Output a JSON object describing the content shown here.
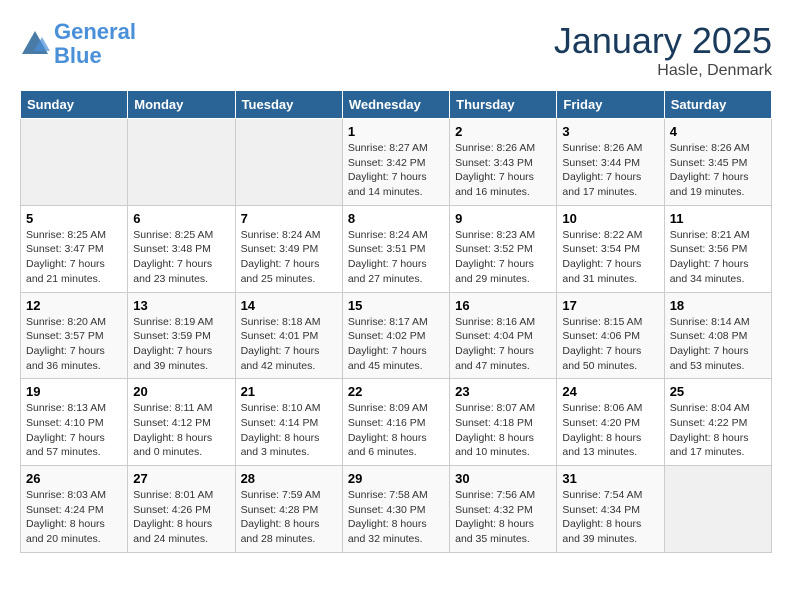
{
  "header": {
    "logo_line1": "General",
    "logo_line2": "Blue",
    "month": "January 2025",
    "location": "Hasle, Denmark"
  },
  "days_of_week": [
    "Sunday",
    "Monday",
    "Tuesday",
    "Wednesday",
    "Thursday",
    "Friday",
    "Saturday"
  ],
  "weeks": [
    [
      {
        "num": "",
        "info": ""
      },
      {
        "num": "",
        "info": ""
      },
      {
        "num": "",
        "info": ""
      },
      {
        "num": "1",
        "info": "Sunrise: 8:27 AM\nSunset: 3:42 PM\nDaylight: 7 hours\nand 14 minutes."
      },
      {
        "num": "2",
        "info": "Sunrise: 8:26 AM\nSunset: 3:43 PM\nDaylight: 7 hours\nand 16 minutes."
      },
      {
        "num": "3",
        "info": "Sunrise: 8:26 AM\nSunset: 3:44 PM\nDaylight: 7 hours\nand 17 minutes."
      },
      {
        "num": "4",
        "info": "Sunrise: 8:26 AM\nSunset: 3:45 PM\nDaylight: 7 hours\nand 19 minutes."
      }
    ],
    [
      {
        "num": "5",
        "info": "Sunrise: 8:25 AM\nSunset: 3:47 PM\nDaylight: 7 hours\nand 21 minutes."
      },
      {
        "num": "6",
        "info": "Sunrise: 8:25 AM\nSunset: 3:48 PM\nDaylight: 7 hours\nand 23 minutes."
      },
      {
        "num": "7",
        "info": "Sunrise: 8:24 AM\nSunset: 3:49 PM\nDaylight: 7 hours\nand 25 minutes."
      },
      {
        "num": "8",
        "info": "Sunrise: 8:24 AM\nSunset: 3:51 PM\nDaylight: 7 hours\nand 27 minutes."
      },
      {
        "num": "9",
        "info": "Sunrise: 8:23 AM\nSunset: 3:52 PM\nDaylight: 7 hours\nand 29 minutes."
      },
      {
        "num": "10",
        "info": "Sunrise: 8:22 AM\nSunset: 3:54 PM\nDaylight: 7 hours\nand 31 minutes."
      },
      {
        "num": "11",
        "info": "Sunrise: 8:21 AM\nSunset: 3:56 PM\nDaylight: 7 hours\nand 34 minutes."
      }
    ],
    [
      {
        "num": "12",
        "info": "Sunrise: 8:20 AM\nSunset: 3:57 PM\nDaylight: 7 hours\nand 36 minutes."
      },
      {
        "num": "13",
        "info": "Sunrise: 8:19 AM\nSunset: 3:59 PM\nDaylight: 7 hours\nand 39 minutes."
      },
      {
        "num": "14",
        "info": "Sunrise: 8:18 AM\nSunset: 4:01 PM\nDaylight: 7 hours\nand 42 minutes."
      },
      {
        "num": "15",
        "info": "Sunrise: 8:17 AM\nSunset: 4:02 PM\nDaylight: 7 hours\nand 45 minutes."
      },
      {
        "num": "16",
        "info": "Sunrise: 8:16 AM\nSunset: 4:04 PM\nDaylight: 7 hours\nand 47 minutes."
      },
      {
        "num": "17",
        "info": "Sunrise: 8:15 AM\nSunset: 4:06 PM\nDaylight: 7 hours\nand 50 minutes."
      },
      {
        "num": "18",
        "info": "Sunrise: 8:14 AM\nSunset: 4:08 PM\nDaylight: 7 hours\nand 53 minutes."
      }
    ],
    [
      {
        "num": "19",
        "info": "Sunrise: 8:13 AM\nSunset: 4:10 PM\nDaylight: 7 hours\nand 57 minutes."
      },
      {
        "num": "20",
        "info": "Sunrise: 8:11 AM\nSunset: 4:12 PM\nDaylight: 8 hours\nand 0 minutes."
      },
      {
        "num": "21",
        "info": "Sunrise: 8:10 AM\nSunset: 4:14 PM\nDaylight: 8 hours\nand 3 minutes."
      },
      {
        "num": "22",
        "info": "Sunrise: 8:09 AM\nSunset: 4:16 PM\nDaylight: 8 hours\nand 6 minutes."
      },
      {
        "num": "23",
        "info": "Sunrise: 8:07 AM\nSunset: 4:18 PM\nDaylight: 8 hours\nand 10 minutes."
      },
      {
        "num": "24",
        "info": "Sunrise: 8:06 AM\nSunset: 4:20 PM\nDaylight: 8 hours\nand 13 minutes."
      },
      {
        "num": "25",
        "info": "Sunrise: 8:04 AM\nSunset: 4:22 PM\nDaylight: 8 hours\nand 17 minutes."
      }
    ],
    [
      {
        "num": "26",
        "info": "Sunrise: 8:03 AM\nSunset: 4:24 PM\nDaylight: 8 hours\nand 20 minutes."
      },
      {
        "num": "27",
        "info": "Sunrise: 8:01 AM\nSunset: 4:26 PM\nDaylight: 8 hours\nand 24 minutes."
      },
      {
        "num": "28",
        "info": "Sunrise: 7:59 AM\nSunset: 4:28 PM\nDaylight: 8 hours\nand 28 minutes."
      },
      {
        "num": "29",
        "info": "Sunrise: 7:58 AM\nSunset: 4:30 PM\nDaylight: 8 hours\nand 32 minutes."
      },
      {
        "num": "30",
        "info": "Sunrise: 7:56 AM\nSunset: 4:32 PM\nDaylight: 8 hours\nand 35 minutes."
      },
      {
        "num": "31",
        "info": "Sunrise: 7:54 AM\nSunset: 4:34 PM\nDaylight: 8 hours\nand 39 minutes."
      },
      {
        "num": "",
        "info": ""
      }
    ]
  ]
}
